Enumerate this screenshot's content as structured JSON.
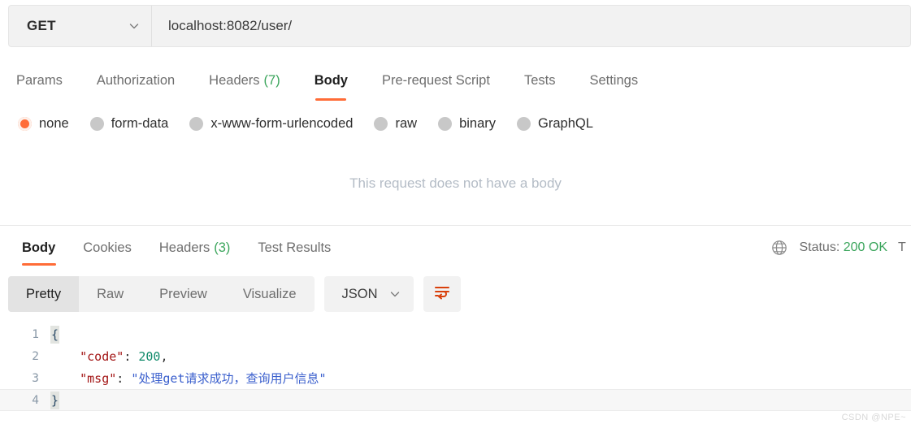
{
  "request": {
    "method": "GET",
    "url": "localhost:8082/user/",
    "tabs": [
      {
        "label": "Params",
        "active": false,
        "count": null
      },
      {
        "label": "Authorization",
        "active": false,
        "count": null
      },
      {
        "label": "Headers",
        "active": false,
        "count": "(7)"
      },
      {
        "label": "Body",
        "active": true,
        "count": null
      },
      {
        "label": "Pre-request Script",
        "active": false,
        "count": null
      },
      {
        "label": "Tests",
        "active": false,
        "count": null
      },
      {
        "label": "Settings",
        "active": false,
        "count": null
      }
    ],
    "body_types": [
      {
        "label": "none",
        "selected": true
      },
      {
        "label": "form-data",
        "selected": false
      },
      {
        "label": "x-www-form-urlencoded",
        "selected": false
      },
      {
        "label": "raw",
        "selected": false
      },
      {
        "label": "binary",
        "selected": false
      },
      {
        "label": "GraphQL",
        "selected": false
      }
    ],
    "empty_body_message": "This request does not have a body"
  },
  "response": {
    "tabs": [
      {
        "label": "Body",
        "active": true,
        "count": null
      },
      {
        "label": "Cookies",
        "active": false,
        "count": null
      },
      {
        "label": "Headers",
        "active": false,
        "count": "(3)"
      },
      {
        "label": "Test Results",
        "active": false,
        "count": null
      }
    ],
    "status_label": "Status:",
    "status_value": "200 OK",
    "time_truncated": "T",
    "view_modes": [
      {
        "label": "Pretty",
        "active": true
      },
      {
        "label": "Raw",
        "active": false
      },
      {
        "label": "Preview",
        "active": false
      },
      {
        "label": "Visualize",
        "active": false
      }
    ],
    "format": "JSON",
    "lines": [
      {
        "num": "1",
        "highlight": false,
        "tokens": [
          {
            "t": "{",
            "c": "brace"
          }
        ]
      },
      {
        "num": "2",
        "highlight": false,
        "tokens": [
          {
            "t": "    ",
            "c": "j-punct"
          },
          {
            "t": "\"code\"",
            "c": "j-key"
          },
          {
            "t": ": ",
            "c": "j-punct"
          },
          {
            "t": "200",
            "c": "j-num"
          },
          {
            "t": ",",
            "c": "j-punct"
          }
        ]
      },
      {
        "num": "3",
        "highlight": false,
        "tokens": [
          {
            "t": "    ",
            "c": "j-punct"
          },
          {
            "t": "\"msg\"",
            "c": "j-key"
          },
          {
            "t": ": ",
            "c": "j-punct"
          },
          {
            "t": "\"处理get请求成功，查询用户信息\"",
            "c": "j-str"
          }
        ]
      },
      {
        "num": "4",
        "highlight": true,
        "tokens": [
          {
            "t": "}",
            "c": "brace"
          }
        ]
      }
    ]
  },
  "colors": {
    "accent": "#ff6c37",
    "status_ok": "#3ba55c",
    "json_key": "#a31515",
    "json_number": "#0f8a6a",
    "json_string": "#3a5fcd",
    "muted_text": "#6e6e6e"
  },
  "watermark": "CSDN @NPE~"
}
